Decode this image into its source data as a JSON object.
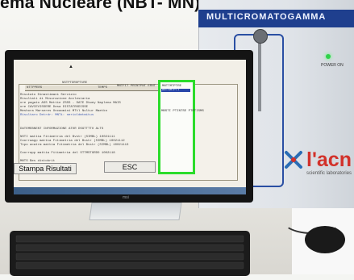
{
  "caption": {
    "title": "ema Nucleare (NBT- MN)."
  },
  "instrument": {
    "model": "MULTICROMATOGAMMA",
    "led_label": "POWER ON",
    "brand": "l'acn",
    "brand_sub": "scientific laboratories",
    "led_color": "#2fd24a",
    "header_color": "#1f3f8e"
  },
  "monitor": {
    "brand": "msi"
  },
  "screen": {
    "tabs": [
      "NTTPPERS",
      "NSTPTDROPTURE",
      "TEMPS",
      "MNTFIT PRINTPNT ERNT"
    ],
    "lines": [
      "Risutato Dinastimani Servizio",
      "Risultati di Misurazione Acclesiaria",
      "ore pagato ASS Mettie ZSSS - DATE    Dtwey Naplena MAIS",
      "ore CAVIEVISSERE   Desa DISTATRODISSE",
      "Meshora Marseres Oncaomini MTtl   Nultur Maetkn",
      "Risultaro Detrdr: MNTi: nerioldmtmitus",
      "",
      "DATEMEBNENT INFORMAZIONE ATOR    DSGTTTTO ALTS",
      "",
      "NSTI        mattia Fitimetria del Bvstr (SIMBL)  10021111",
      "Coorraapp   mattia Fitimetria del Bvstr (SIMBL)  10021112",
      "Tipo acatrm mattia Fitimetria del Bvstr (SIMBL)  10021113",
      "",
      "Coorrapp    mattia Fitimetria del STTMSTGRDO  1002118",
      "",
      "MNTS Bes distobrit"
    ],
    "green_items": [
      "MNTTMTPTRE",
      "ARTSMTPTT"
    ],
    "green_footer": "MBSTI PTINTSE PTRTISMS",
    "buttons": {
      "print": "Stampa Risultati",
      "esc": "ESC"
    },
    "accent_green": "#2bdc2b",
    "selection_blue": "#2846a8"
  }
}
